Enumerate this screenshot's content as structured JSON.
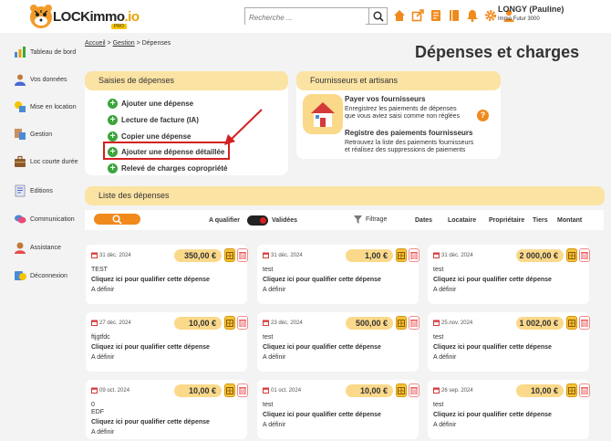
{
  "brand": {
    "name_main": "LOCKimmo",
    "name_accent": ".io",
    "tag": "PRO"
  },
  "search": {
    "placeholder": "Recherche ..."
  },
  "user": {
    "name": "LONGY (Pauline)",
    "company": "Immo Futur 3000"
  },
  "sidebar": [
    {
      "label": "Tableau de bord",
      "icon": "dashboard-icon"
    },
    {
      "label": "Vos données",
      "icon": "user-data-icon"
    },
    {
      "label": "Mise en location",
      "icon": "rental-icon"
    },
    {
      "label": "Gestion",
      "icon": "management-icon"
    },
    {
      "label": "Loc courte durée",
      "icon": "suitcase-icon"
    },
    {
      "label": "Editions",
      "icon": "editions-icon"
    },
    {
      "label": "Communication",
      "icon": "communication-icon"
    },
    {
      "label": "Assistance",
      "icon": "assistance-icon"
    },
    {
      "label": "Déconnexion",
      "icon": "logout-icon"
    }
  ],
  "breadcrumb": {
    "home": "Accueil",
    "section": "Gestion",
    "current": "Dépenses",
    "sep": ">"
  },
  "page_title": "Dépenses et charges",
  "saisies": {
    "title": "Saisies de dépenses",
    "actions": [
      "Ajouter une dépense",
      "Lecture de facture (IA)",
      "Copier une dépense",
      "Ajouter une dépense détaillée",
      "Relevé de charges copropriété"
    ]
  },
  "fournisseurs": {
    "title": "Fournisseurs et artisans",
    "pay_title": "Payer vos fournisseurs",
    "pay_desc1": "Enregistrez les paiements de dépenses",
    "pay_desc2": "que vous aviez saisi comme non réglées",
    "reg_title": "Registre des paiements fournisseurs",
    "reg_desc1": "Retrouvez la liste des paiements fournisseurs",
    "reg_desc2": "et réalisez des suppressions de paiements"
  },
  "list": {
    "title": "Liste des dépenses",
    "a_qualifier": "A qualifier",
    "validees": "Validées",
    "filtrage": "Filtrage",
    "sort": [
      "Dates",
      "Locataire",
      "Propriétaire",
      "Tiers",
      "Montant"
    ]
  },
  "cards": [
    {
      "date": "31 déc. 2024",
      "amount": "350,00 €",
      "label": "TEST",
      "action": "Cliquez ici pour qualifier cette dépense",
      "status": "A définir"
    },
    {
      "date": "31 déc. 2024",
      "amount": "1,00 €",
      "label": "test",
      "action": "Cliquez ici pour qualifier cette dépense",
      "status": "A définir"
    },
    {
      "date": "31 déc. 2024",
      "amount": "2 000,00 €",
      "label": "test",
      "action": "Cliquez ici pour qualifier cette dépense",
      "status": "A définir"
    },
    {
      "date": "27 déc. 2024",
      "amount": "10,00 €",
      "label": "ftjgtfdc",
      "action": "Cliquez ici pour qualifier cette dépense",
      "status": "A définir"
    },
    {
      "date": "23 déc. 2024",
      "amount": "500,00 €",
      "label": "test",
      "action": "Cliquez ici pour qualifier cette dépense",
      "status": "A définir"
    },
    {
      "date": "25.nov. 2024",
      "amount": "1 002,00 €",
      "label": "test",
      "action": "Cliquez ici pour qualifier cette dépense",
      "status": "A définir"
    },
    {
      "date": "09 oct. 2024",
      "amount": "10,00 €",
      "label": "0",
      "label2": "EDF",
      "action": "Cliquez ici pour qualifier cette dépense",
      "status": "A définir"
    },
    {
      "date": "01 oct. 2024",
      "amount": "10,00 €",
      "label": "test",
      "action": "Cliquez ici pour qualifier cette dépense",
      "status": "A définir"
    },
    {
      "date": "26 sep. 2024",
      "amount": "10,00 €",
      "label": "test",
      "action": "Cliquez ici pour qualifier cette dépense",
      "status": "A définir"
    }
  ],
  "colors": {
    "accent": "#f08a1c",
    "header_bg": "#fbe3a4",
    "add": "#3aa63a",
    "highlight": "#d42020"
  }
}
